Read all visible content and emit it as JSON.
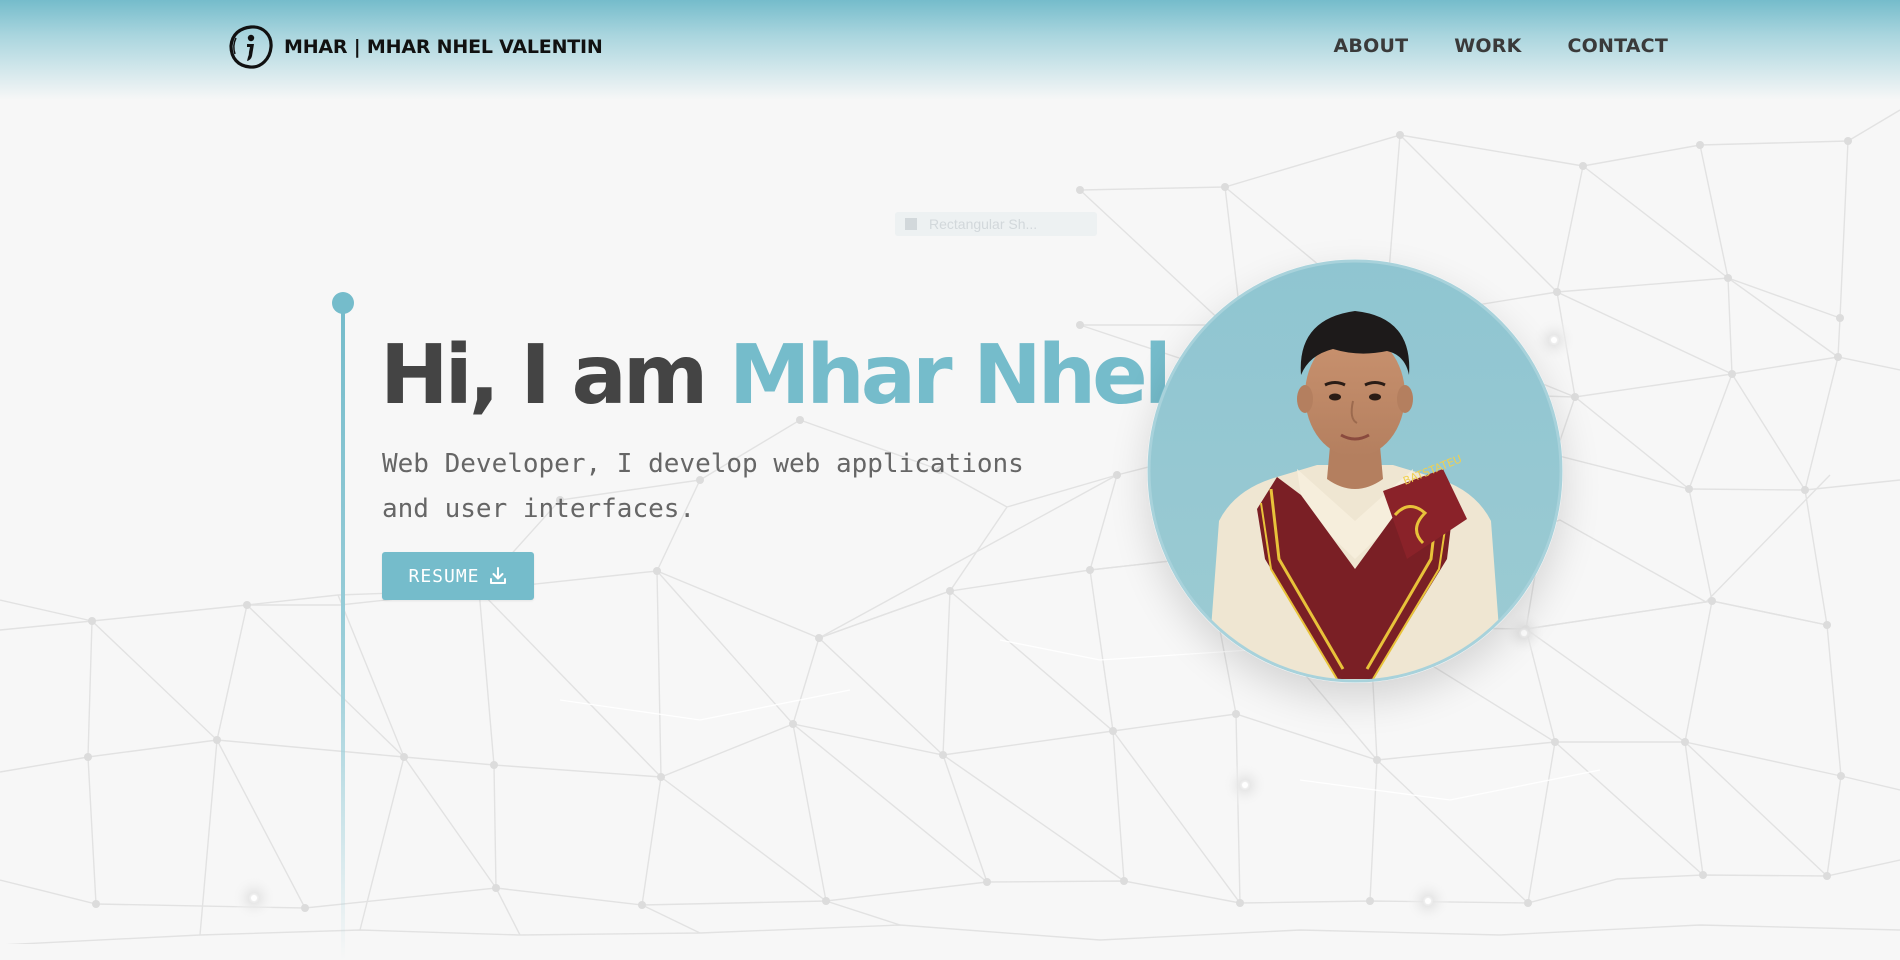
{
  "brand": {
    "logo_icon": "info-circle-logo-icon",
    "text": "MHAR | MHAR NHEL VALENTIN"
  },
  "nav": [
    {
      "label": "ABOUT"
    },
    {
      "label": "WORK"
    },
    {
      "label": "CONTACT"
    }
  ],
  "hero": {
    "title_prefix": "Hi, I am ",
    "title_name": "Mhar Nhel",
    "subtitle": "Web Developer, I develop web applications and user interfaces.",
    "resume_label": "RESUME",
    "resume_icon": "download-icon"
  },
  "ghost_tooltip": {
    "text": "Rectangular Sh..."
  },
  "portrait": {
    "icon": "profile-photo",
    "sash_text": "BATSTATEU"
  },
  "colors": {
    "accent": "#75bccb",
    "heading": "#444444",
    "body_text": "#666666",
    "background": "#f7f7f7"
  }
}
